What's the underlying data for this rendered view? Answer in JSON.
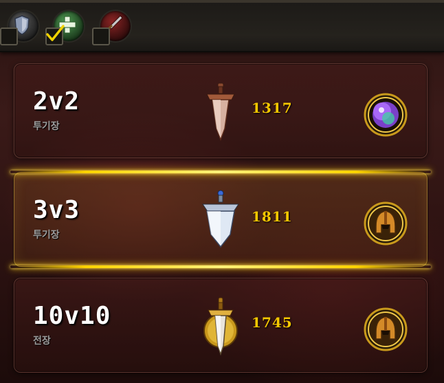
{
  "roles": [
    {
      "name": "tank",
      "icon": "shield-icon",
      "checked": false
    },
    {
      "name": "healer",
      "icon": "healer-cross-icon",
      "checked": true
    },
    {
      "name": "damage",
      "icon": "sword-icon",
      "checked": false
    }
  ],
  "brackets": [
    {
      "title": "2v2",
      "type": "투기장",
      "rating": "1317",
      "rank_icon": "copper-sword-rank-icon",
      "reward_icon": "gem-orb-icon",
      "selected": false
    },
    {
      "title": "3v3",
      "type": "투기장",
      "rating": "1811",
      "rank_icon": "silver-sword-rank-icon",
      "reward_icon": "spartan-helmet-icon",
      "selected": true
    },
    {
      "title": "10v10",
      "type": "전장",
      "rating": "1745",
      "rank_icon": "gold-sword-rank-icon",
      "reward_icon": "spartan-helmet-icon",
      "selected": false
    }
  ],
  "colors": {
    "rating": "#f6c800",
    "selection_glow": "#ffd400",
    "type_label": "#9c9c9c"
  }
}
